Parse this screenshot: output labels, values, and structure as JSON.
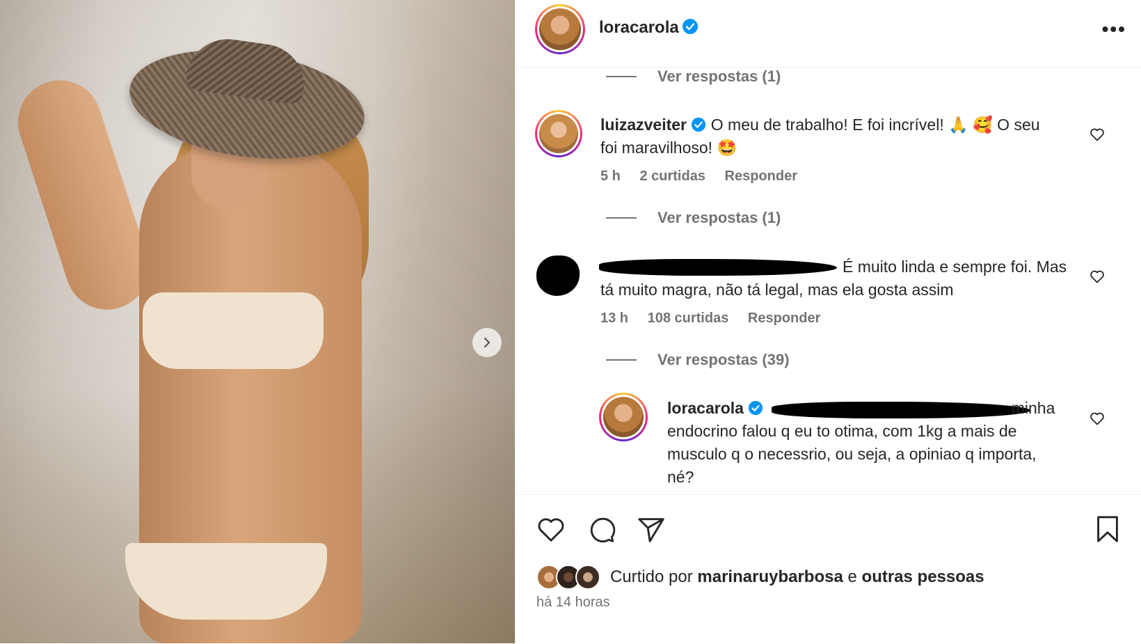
{
  "post": {
    "author": "loracarola",
    "more_label": "•••"
  },
  "comments": [
    {
      "type": "reply_link",
      "label": "Ver respostas (1)"
    },
    {
      "type": "comment",
      "username": "luizazveiter",
      "text_line1": "O meu de trabalho! E foi incrível! 🙏 🥰 O seu",
      "text_line2": "foi maravilhoso! 🤩",
      "time": "5 h",
      "likes": "2 curtidas",
      "reply": "Responder"
    },
    {
      "type": "reply_link",
      "label": "Ver respostas (1)"
    },
    {
      "type": "comment",
      "username": "",
      "text_line1": "É muito linda e sempre foi. Mas",
      "text_line2": "tá muito magra, não tá legal, mas ela gosta assim",
      "time": "13 h",
      "likes": "108 curtidas",
      "reply": "Responder"
    },
    {
      "type": "reply_link",
      "label": "Ver respostas (39)"
    },
    {
      "type": "reply",
      "username": "loracarola",
      "text_line1": "minha",
      "text_line2": "endocrino falou q eu to otima, com 1kg a mais de",
      "text_line3": "musculo q o necessrio, ou seja, a opiniao q importa,",
      "text_line4": "né?"
    }
  ],
  "footer": {
    "liked_prefix": "Curtido por",
    "liked_user": "marinaruybarbosa",
    "liked_conj": "e",
    "liked_others": "outras pessoas",
    "posted_time": "há 14 horas"
  },
  "colors": {
    "verified": "#0095f6",
    "text": "#262626",
    "secondary": "#737373"
  },
  "icons": [
    "verified-icon",
    "more-icon",
    "heart-icon",
    "comment-icon",
    "share-icon",
    "bookmark-icon",
    "chevron-right-icon"
  ]
}
